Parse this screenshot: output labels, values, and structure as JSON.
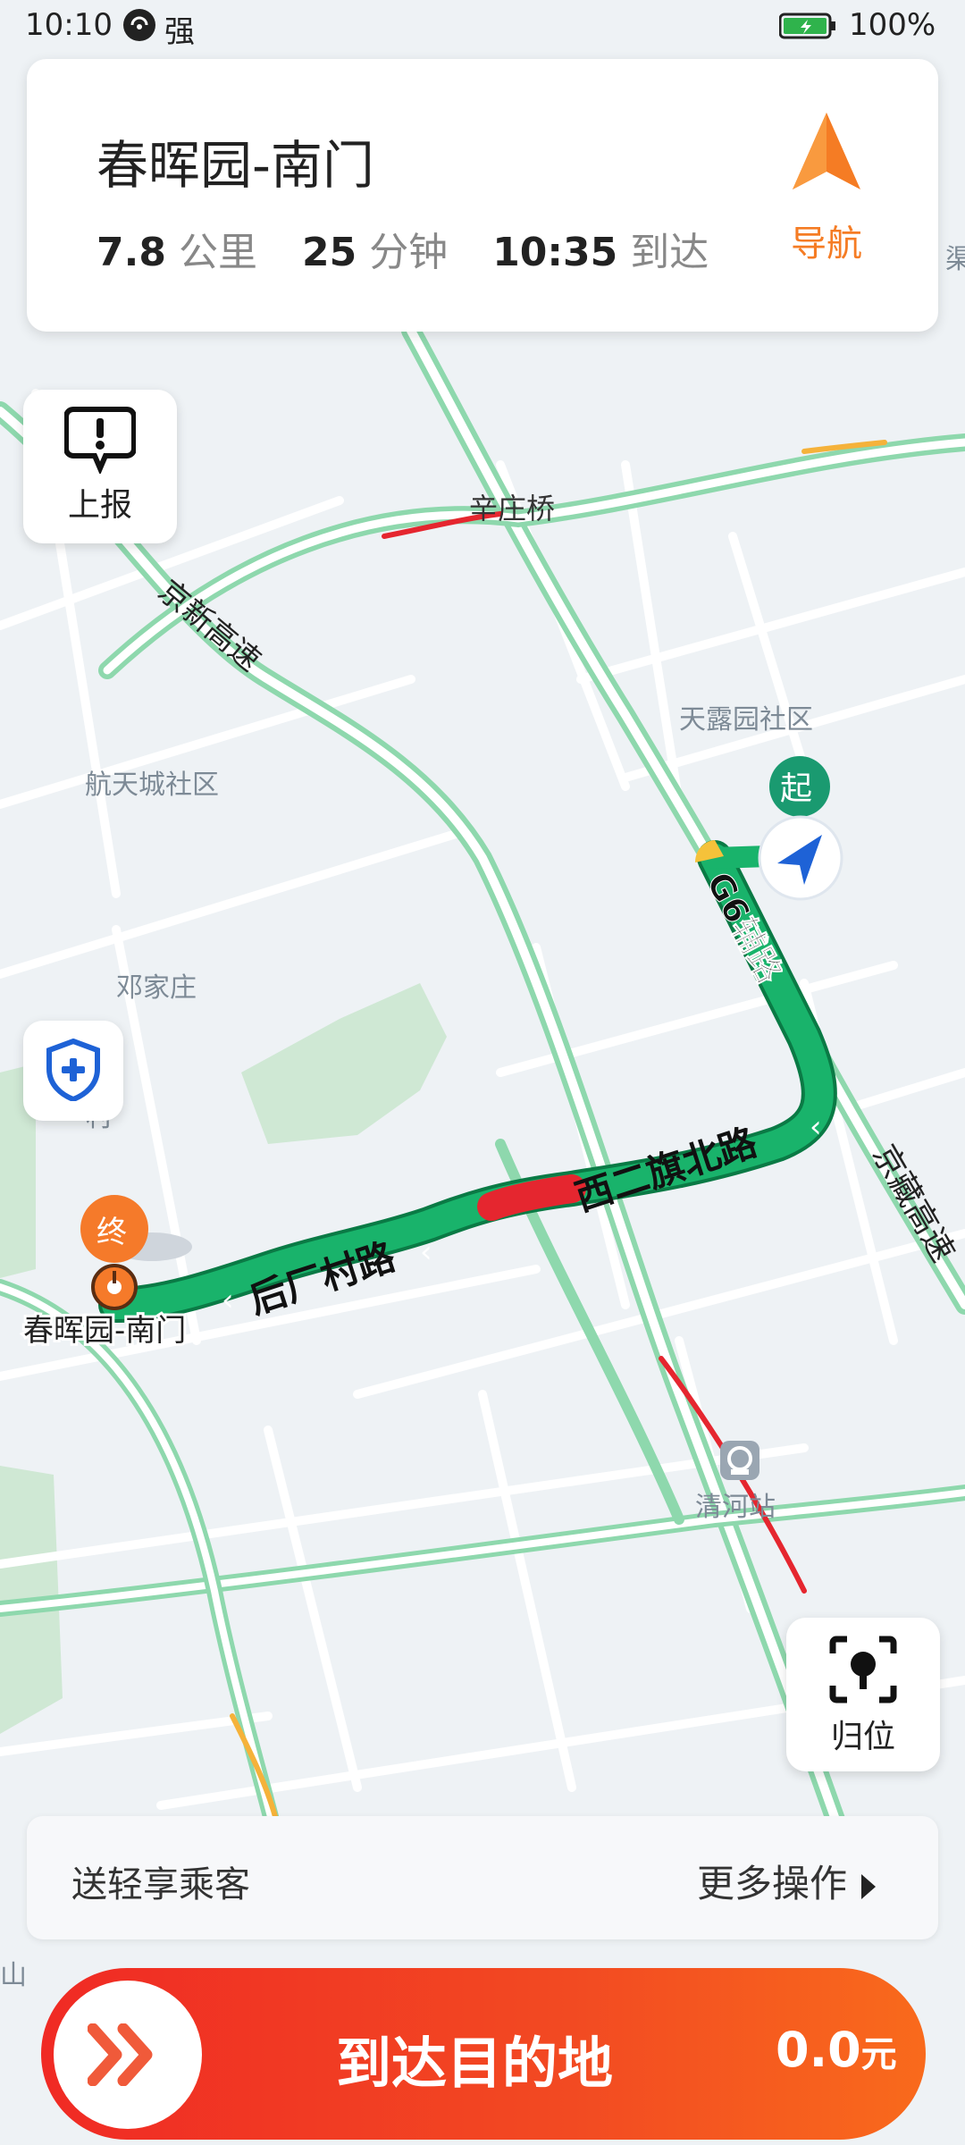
{
  "status_bar": {
    "time": "10:10",
    "signal_label": "强",
    "battery_percent": "100%",
    "battery_charging": true,
    "battery_level": 1.0
  },
  "destination_card": {
    "title": "春晖园-南门",
    "distance_value": "7.8",
    "distance_unit": "公里",
    "duration_value": "25",
    "duration_unit": "分钟",
    "arrival_time": "10:35",
    "arrival_suffix": "到达",
    "navigate_label": "导航"
  },
  "tools": {
    "report_label": "上报",
    "locate_label": "归位"
  },
  "map": {
    "start_marker": "起",
    "end_marker": "终",
    "end_label": "春晖园-南门",
    "road_labels": [
      "京新高速",
      "辛庄桥",
      "G6辅路",
      "西二旗北路",
      "后厂村路",
      "京藏高速"
    ],
    "place_labels": [
      "天露园社区",
      "航天城社区",
      "邓家庄",
      "村",
      "清河站",
      "山",
      "渠"
    ]
  },
  "bottom": {
    "passenger_label": "送轻享乘客",
    "more_ops_label": "更多操作",
    "arrive_label": "到达目的地",
    "fare_amount": "0.0",
    "fare_unit": "元"
  },
  "colors": {
    "route_green": "#19b36b",
    "route_congested": "#e5262f",
    "nav_orange": "#f57c24",
    "slider_red": "#f02a24",
    "road_green": "#8ed8ad",
    "blue_accent": "#1e62d6"
  }
}
